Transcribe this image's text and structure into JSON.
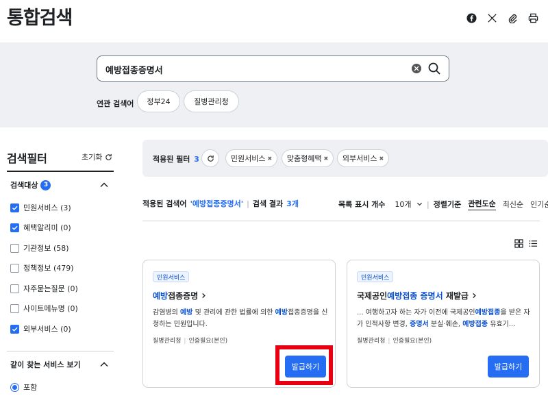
{
  "header": {
    "title": "통합검색",
    "icons": [
      "facebook-icon",
      "x-icon",
      "paperclip-icon",
      "print-icon"
    ]
  },
  "search": {
    "value": "예방접종증명서",
    "related_label": "연관 검색어",
    "related": [
      "정부24",
      "질병관리청"
    ]
  },
  "sidebar": {
    "title": "검색필터",
    "reset_label": "초기화",
    "category_title": "검색대상",
    "category_count": "3",
    "items": [
      {
        "label": "민원서비스 (3)",
        "checked": true
      },
      {
        "label": "혜택알리미 (0)",
        "checked": true
      },
      {
        "label": "기관정보 (58)",
        "checked": false
      },
      {
        "label": "정책정보 (479)",
        "checked": false
      },
      {
        "label": "자주묻는질문 (0)",
        "checked": false
      },
      {
        "label": "사이트메뉴명 (0)",
        "checked": false
      },
      {
        "label": "외부서비스 (0)",
        "checked": true
      }
    ],
    "together_title": "같이 찾는 서비스 보기",
    "radio_label": "포함"
  },
  "applied": {
    "label": "적용된 필터",
    "count": "3",
    "chips": [
      "민원서비스",
      "맞춤형혜택",
      "외부서비스"
    ]
  },
  "results": {
    "applied_term_label": "적용된 검색어",
    "applied_term": "'예방접종증명서'",
    "result_label": "검색 결과",
    "result_count": "3개",
    "per_page_label": "목록 표시 개수",
    "per_page_value": "10개",
    "sort_label": "정렬기준",
    "sort_options": [
      "관련도순",
      "최신순",
      "인기순"
    ]
  },
  "cards": [
    {
      "tag": "민원서비스",
      "title_hl": "예방",
      "title_rest": "접종증명",
      "desc_1": "감염병의 ",
      "desc_2": "예방",
      "desc_3": " 및 관리에 관한 법률에 의한 ",
      "desc_4": "예방",
      "desc_5": "접종증명을 신청하는 민원입니다.",
      "org": "질병관리청",
      "auth": "인증필요(본인)",
      "button": "발급하기"
    },
    {
      "tag": "민원서비스",
      "title_pre": "국제공인",
      "title_hl": "예방접종 증명서",
      "title_rest": " 재발급",
      "desc_1": "... 여행하고자 하는 자가 이전에 국제공인",
      "desc_2": "예방접종",
      "desc_3": "을 받은 자가 인적사항 변경, ",
      "desc_4": "증명서",
      "desc_5": " 분실·훼손, ",
      "desc_6": "예방접종",
      "desc_7": " 유효기...",
      "org": "질병관리청",
      "auth": "인증필요(본인)",
      "button": "발급하기"
    }
  ],
  "colors": {
    "accent": "#256ef4",
    "highlight_frame": "#e60012",
    "band": "#eef0f3"
  }
}
